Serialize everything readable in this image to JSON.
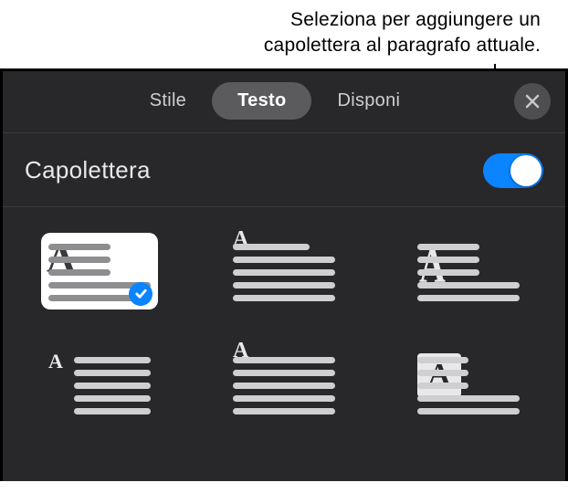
{
  "callout": {
    "line1": "Seleziona per aggiungere un",
    "line2": "capolettera al paragrafo attuale."
  },
  "tabs": {
    "stile": "Stile",
    "testo": "Testo",
    "disponi": "Disponi"
  },
  "section": {
    "capolettera_label": "Capolettera",
    "toggle_on": true
  },
  "dropCapOptions": [
    {
      "id": "dropcap-style-1",
      "selected": true
    },
    {
      "id": "dropcap-style-2",
      "selected": false
    },
    {
      "id": "dropcap-style-3",
      "selected": false
    },
    {
      "id": "dropcap-style-4",
      "selected": false
    },
    {
      "id": "dropcap-style-5",
      "selected": false
    },
    {
      "id": "dropcap-style-6",
      "selected": false
    }
  ]
}
